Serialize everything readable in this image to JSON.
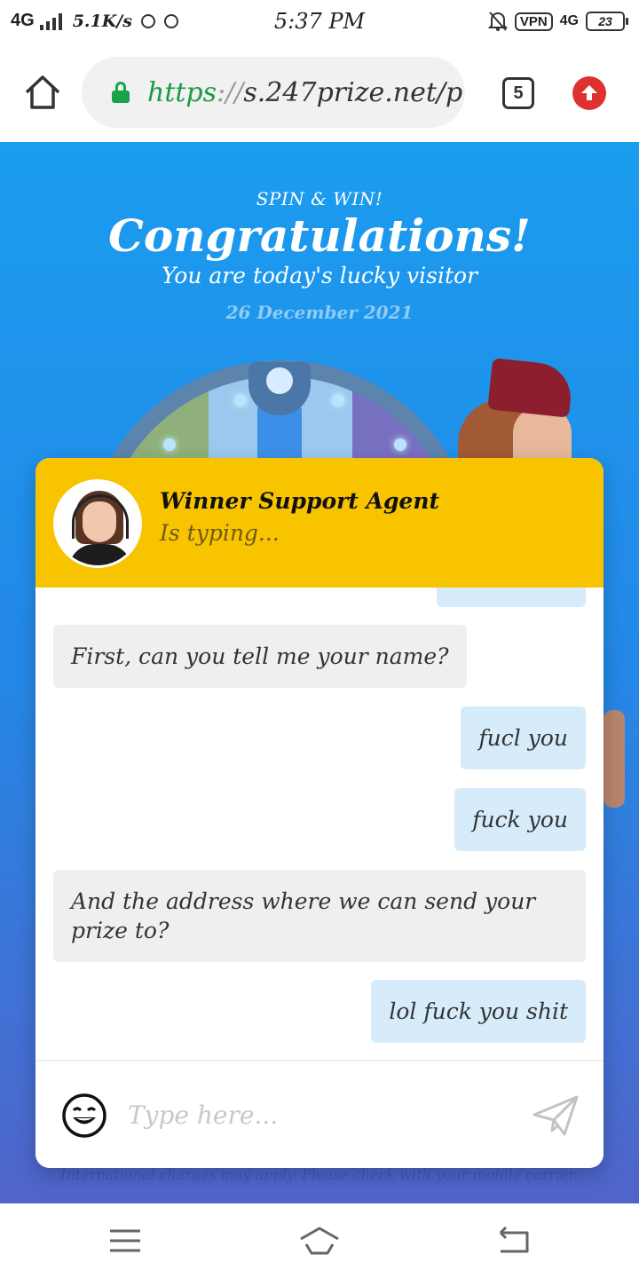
{
  "status_bar": {
    "network": "4G",
    "speed": "5.1K/s",
    "time": "5:37 PM",
    "vpn": "VPN",
    "network_right": "4G",
    "battery": "23"
  },
  "browser": {
    "url_scheme": "https",
    "url_sep": "://",
    "url_rest": "s.247prize.net/p",
    "tab_count": "5"
  },
  "hero": {
    "kicker": "SPIN & WIN!",
    "title": "Congratulations!",
    "subtitle": "You are today's lucky visitor",
    "date": "26 December 2021"
  },
  "chat": {
    "agent_name": "Winner Support Agent",
    "agent_status": "Is typing...",
    "messages": [
      {
        "from": "agent",
        "text": "First, can you tell me your name?"
      },
      {
        "from": "user",
        "text": "fucl you"
      },
      {
        "from": "user",
        "text": "fuck you"
      },
      {
        "from": "agent",
        "text": "And the address where we can send your\nprize to?"
      },
      {
        "from": "user",
        "text": "lol fuck you shit"
      }
    ],
    "input_placeholder": "Type here..."
  },
  "footnote": "International charges may apply. Please check with your mobile carrier.",
  "colors": {
    "header_yellow": "#f8c400",
    "page_blue": "#1a9cef",
    "user_bubble": "#d6ecfb",
    "agent_bubble": "#efefef",
    "lock_green": "#1aa34a",
    "upload_red": "#e03131"
  },
  "icons": {
    "home": "home-icon",
    "lock": "lock-icon",
    "upload": "upload-icon",
    "emoji": "smile-emoji-icon",
    "send": "paper-plane-icon",
    "nav_menu": "menu-icon",
    "nav_home": "home-outline-icon",
    "nav_back": "back-icon"
  }
}
